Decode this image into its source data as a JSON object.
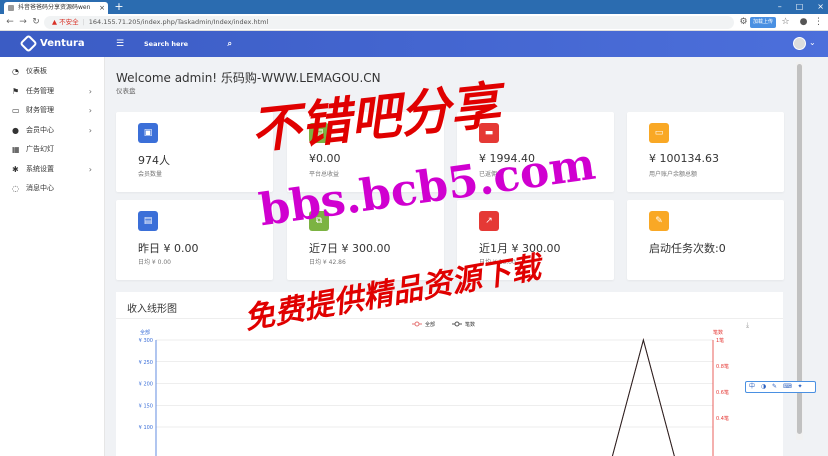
{
  "browser": {
    "tab_title": "抖音爸爸码分享资源码wen",
    "url_warning": "不安全",
    "url": "164.155.71.205/index.php/Taskadmin/Index/index.html",
    "ext_badge": "加载上传"
  },
  "header": {
    "brand": "Ventura",
    "search_placeholder": "Search here"
  },
  "sidebar": {
    "items": [
      {
        "label": "仪表板",
        "icon": "dashboard-icon",
        "has_arrow": false
      },
      {
        "label": "任务管理",
        "icon": "flag-icon",
        "has_arrow": true
      },
      {
        "label": "财务管理",
        "icon": "inbox-icon",
        "has_arrow": true
      },
      {
        "label": "会员中心",
        "icon": "user-icon",
        "has_arrow": true
      },
      {
        "label": "广告幻灯",
        "icon": "grid-icon",
        "has_arrow": false
      },
      {
        "label": "系统设置",
        "icon": "gear-icon",
        "has_arrow": true
      },
      {
        "label": "消息中心",
        "icon": "message-icon",
        "has_arrow": false
      }
    ]
  },
  "main": {
    "welcome": "Welcome admin! 乐码购-WWW.LEMAGOU.CN",
    "subtitle": "仪表盘",
    "stats": [
      {
        "value": "974人",
        "label": "会员数量",
        "color": "#3b6fd8",
        "icon": "user-card-icon"
      },
      {
        "value": "¥0.00",
        "label": "平台总收益",
        "color": "#7cb342",
        "icon": "money-icon"
      },
      {
        "value": "¥ 1994.40",
        "label": "已返佣金",
        "color": "#e53935",
        "icon": "card-icon"
      },
      {
        "value": "¥ 100134.63",
        "label": "用户账户余额总额",
        "color": "#f9a825",
        "icon": "folder-icon"
      },
      {
        "value": "昨日 ¥ 0.00",
        "label": "日均 ¥ 0.00",
        "color": "#3b6fd8",
        "icon": "money-icon"
      },
      {
        "value": "近7日 ¥ 300.00",
        "label": "日均 ¥ 42.86",
        "color": "#7cb342",
        "icon": "copy-icon"
      },
      {
        "value": "近1月 ¥ 300.00",
        "label": "日均 ¥ 10.00",
        "color": "#e53935",
        "icon": "trend-icon"
      },
      {
        "value": "启动任务次数:0",
        "label": "",
        "color": "#f9a825",
        "icon": "wrench-icon"
      }
    ],
    "chart_title": "收入线形图"
  },
  "chart_data": {
    "type": "line",
    "title": "收入线形图",
    "legend": [
      "全部",
      "笔数"
    ],
    "legend_position": "top-center",
    "left_axis_label": "全部",
    "right_axis_label": "笔数",
    "left_ticks": [
      "¥ 300",
      "¥ 250",
      "¥ 200",
      "¥ 150",
      "¥ 100"
    ],
    "right_ticks": [
      "1笔",
      "0.8笔",
      "0.6笔",
      "0.4笔"
    ],
    "ylim_left": [
      0,
      300
    ],
    "ylim_right": [
      0,
      1
    ],
    "grid": true,
    "series": [
      {
        "name": "全部",
        "color": "#e57373",
        "values": [
          0,
          0,
          0,
          0,
          0,
          0,
          0,
          0,
          0,
          0,
          0,
          0,
          0,
          0,
          300,
          0,
          0
        ]
      },
      {
        "name": "笔数",
        "color": "#555555",
        "values": [
          0,
          0,
          0,
          0,
          0,
          0,
          0,
          0,
          0,
          0,
          0,
          0,
          0,
          0,
          1,
          0,
          0
        ]
      }
    ]
  },
  "watermarks": {
    "line1": "不错吧分享",
    "line2": "bbs.bcb5.com",
    "line3": "免费提供精品资源下载"
  },
  "ime_bar": "中 ◑ ✎ ⌨ ✦"
}
